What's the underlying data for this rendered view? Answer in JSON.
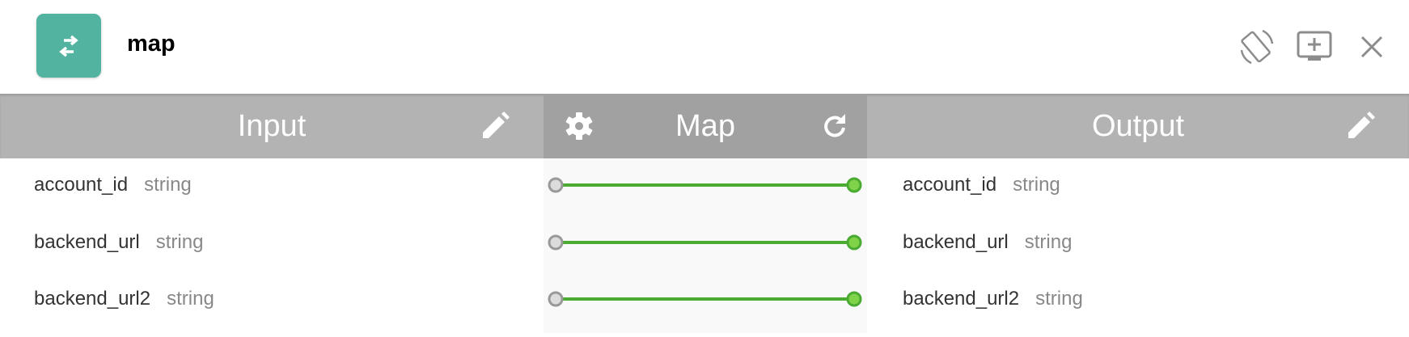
{
  "header": {
    "title": "map",
    "app_icon": "swap-arrows-icon",
    "app_icon_color": "#52b3a1",
    "actions": [
      {
        "icon": "rotate-screen-icon"
      },
      {
        "icon": "add-to-screen-icon"
      },
      {
        "icon": "close-icon"
      }
    ]
  },
  "columns": {
    "input": {
      "label": "Input",
      "icon": "pencil-icon"
    },
    "map": {
      "label": "Map",
      "left_icon": "gear-icon",
      "right_icon": "refresh-icon"
    },
    "output": {
      "label": "Output",
      "icon": "pencil-icon"
    }
  },
  "input_fields": [
    {
      "name": "account_id",
      "type": "string"
    },
    {
      "name": "backend_url",
      "type": "string"
    },
    {
      "name": "backend_url2",
      "type": "string"
    }
  ],
  "output_fields": [
    {
      "name": "account_id",
      "type": "string"
    },
    {
      "name": "backend_url",
      "type": "string"
    },
    {
      "name": "backend_url2",
      "type": "string"
    }
  ],
  "colors": {
    "connector": "#4aaa32",
    "connected_dot": "#7ed348",
    "source_dot": "#dcdcdc"
  }
}
